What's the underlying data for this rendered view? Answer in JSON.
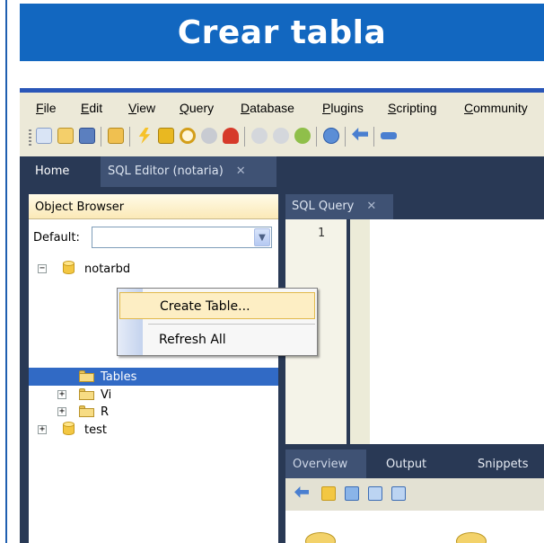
{
  "slide": {
    "title": "Crear tabla",
    "title_bg": "#1267c0"
  },
  "menu": {
    "items": [
      {
        "mnemonic": "F",
        "rest": "ile"
      },
      {
        "mnemonic": "E",
        "rest": "dit"
      },
      {
        "mnemonic": "V",
        "rest": "iew"
      },
      {
        "mnemonic": "Q",
        "rest": "uery"
      },
      {
        "mnemonic": "D",
        "rest": "atabase"
      },
      {
        "mnemonic": "P",
        "rest": "lugins"
      },
      {
        "mnemonic": "S",
        "rest": "cripting"
      },
      {
        "mnemonic": "C",
        "rest": "ommunity"
      }
    ]
  },
  "toolbar": {
    "icons": [
      "new-sql-icon",
      "open-file-icon",
      "save-icon",
      "open-script-icon",
      "execute-icon",
      "execute-current-icon",
      "explain-icon",
      "stop-icon",
      "reconnect-icon",
      "commit-icon",
      "rollback-icon",
      "refresh-icon",
      "options-icon",
      "sync-icon",
      "pin-icon"
    ]
  },
  "tabs": {
    "home": "Home",
    "sql_editor": "SQL Editor (notaria)",
    "close_glyph": "✕"
  },
  "object_browser": {
    "header": "Object Browser",
    "default_label": "Default:",
    "default_value": "",
    "tree": {
      "root_db": "notarbd",
      "tables": "Tables",
      "views": "Vi",
      "routines": "R",
      "other_db": "test"
    }
  },
  "context_menu": {
    "items": [
      "Create Table...",
      "Refresh All"
    ]
  },
  "sql_query": {
    "tab_label": "SQL Query",
    "line_number": "1"
  },
  "bottom_panel": {
    "tabs": [
      "Overview",
      "Output",
      "Snippets"
    ]
  },
  "colors": {
    "dark_panel": "#293955",
    "selection": "#316ac5",
    "menu_highlight": "#fdeec4"
  }
}
